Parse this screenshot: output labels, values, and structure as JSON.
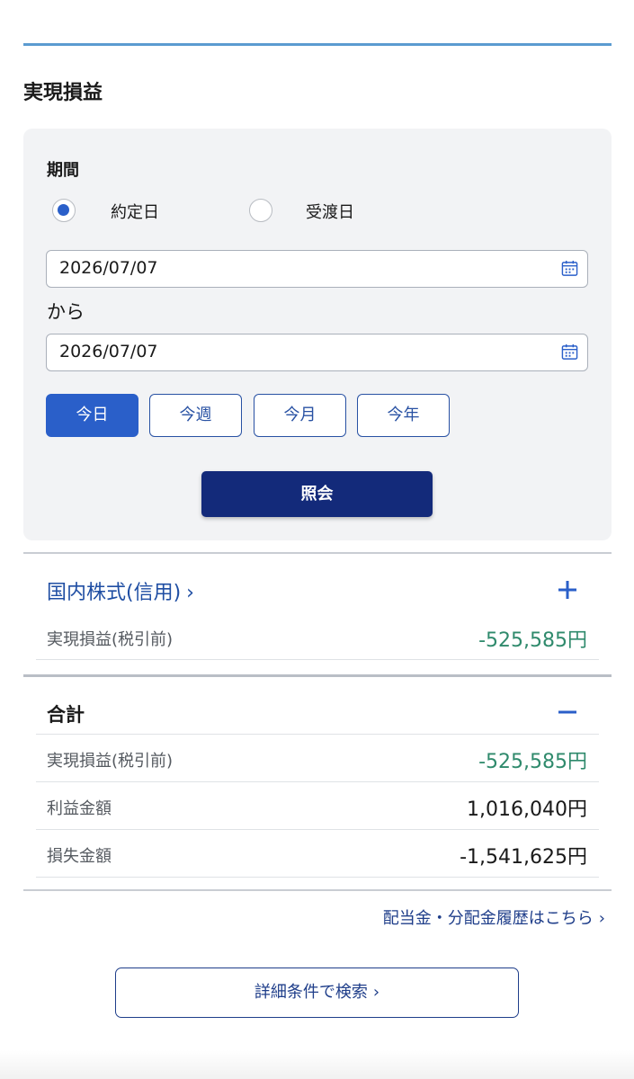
{
  "page": {
    "title": "実現損益"
  },
  "filter": {
    "period_label": "期間",
    "radios": [
      {
        "label": "約定日",
        "checked": true
      },
      {
        "label": "受渡日",
        "checked": false
      }
    ],
    "start_date": "2026/07/07",
    "from_label": "から",
    "end_date": "2026/07/07",
    "quick_buttons": [
      {
        "label": "今日",
        "active": true
      },
      {
        "label": "今週",
        "active": false
      },
      {
        "label": "今月",
        "active": false
      },
      {
        "label": "今年",
        "active": false
      }
    ],
    "query_label": "照会"
  },
  "domestic": {
    "title": "国内株式(信用)",
    "chevron": "›",
    "expand_icon": "plus-icon",
    "rows": [
      {
        "label": "実現損益(税引前)",
        "value": "-525,585円"
      }
    ]
  },
  "total": {
    "title": "合計",
    "collapse_icon": "minus-icon",
    "rows": [
      {
        "label": "実現損益(税引前)",
        "value": "-525,585円"
      },
      {
        "label": "利益金額",
        "value": "1,016,040円"
      },
      {
        "label": "損失金額",
        "value": "-1,541,625円"
      }
    ]
  },
  "links": {
    "dividend": "配当金・分配金履歴はこちら",
    "chevron": "›",
    "advanced": "詳細条件で検索"
  },
  "colors": {
    "accent": "#2a5fc9",
    "primary_button": "#132a7a",
    "link": "#1f4ea3",
    "negative_value": "#2f8a6c",
    "top_rule": "#5b9bd0"
  }
}
